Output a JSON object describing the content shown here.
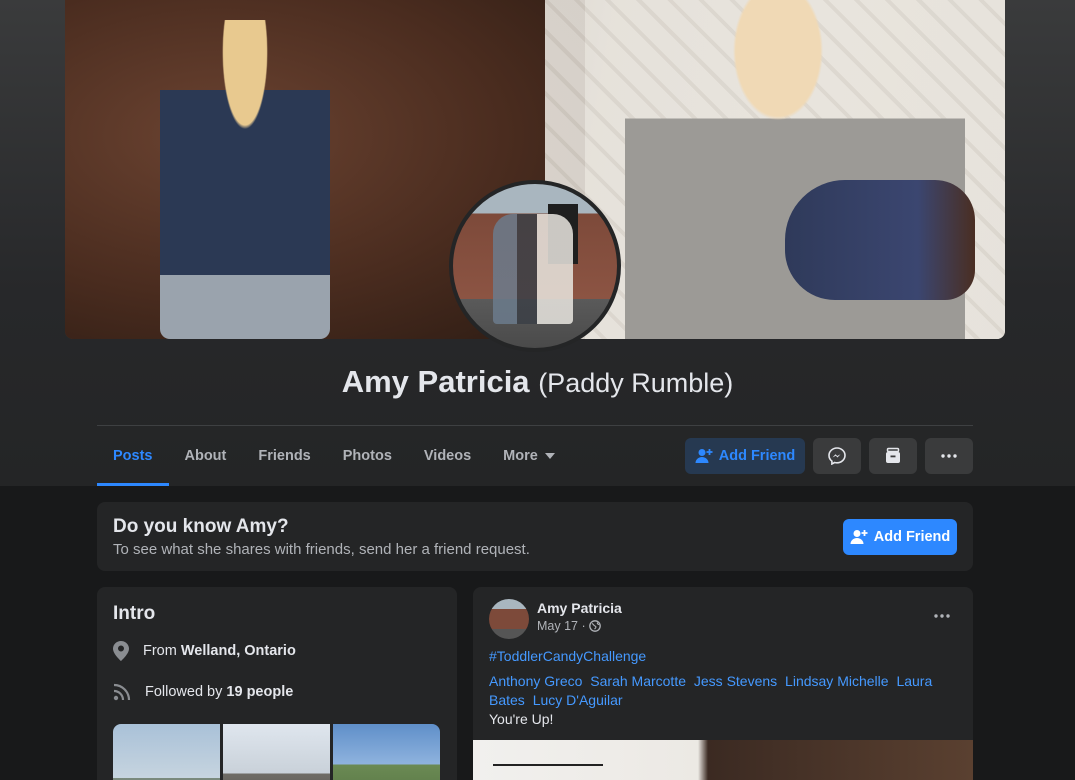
{
  "profile": {
    "name": "Amy Patricia",
    "alternate_name": "(Paddy Rumble)"
  },
  "tabs": [
    {
      "label": "Posts",
      "active": true
    },
    {
      "label": "About"
    },
    {
      "label": "Friends"
    },
    {
      "label": "Photos"
    },
    {
      "label": "Videos"
    },
    {
      "label": "More"
    }
  ],
  "actions": {
    "add_friend_label": "Add Friend",
    "messenger_icon": "messenger-icon",
    "save_icon": "save-icon",
    "more_icon": "ellipsis-icon"
  },
  "know_card": {
    "title": "Do you know Amy?",
    "subtitle": "To see what she shares with friends, send her a friend request.",
    "button_label": "Add Friend"
  },
  "intro": {
    "title": "Intro",
    "from_prefix": "From",
    "from_place": "Welland, Ontario",
    "followed_prefix": "Followed by",
    "followed_count": "19 people"
  },
  "post": {
    "author": "Amy Patricia",
    "date": "May 17 ·",
    "hashtag": "#ToddlerCandyChallenge",
    "tagged": [
      "Anthony Greco",
      "Sarah Marcotte",
      "Jess Stevens",
      "Lindsay Michelle",
      "Laura Bates",
      "Lucy D'Aguilar"
    ],
    "body": "You're Up!"
  },
  "colors": {
    "accent": "#2d88ff",
    "background": "#18191a",
    "card": "#242526"
  }
}
